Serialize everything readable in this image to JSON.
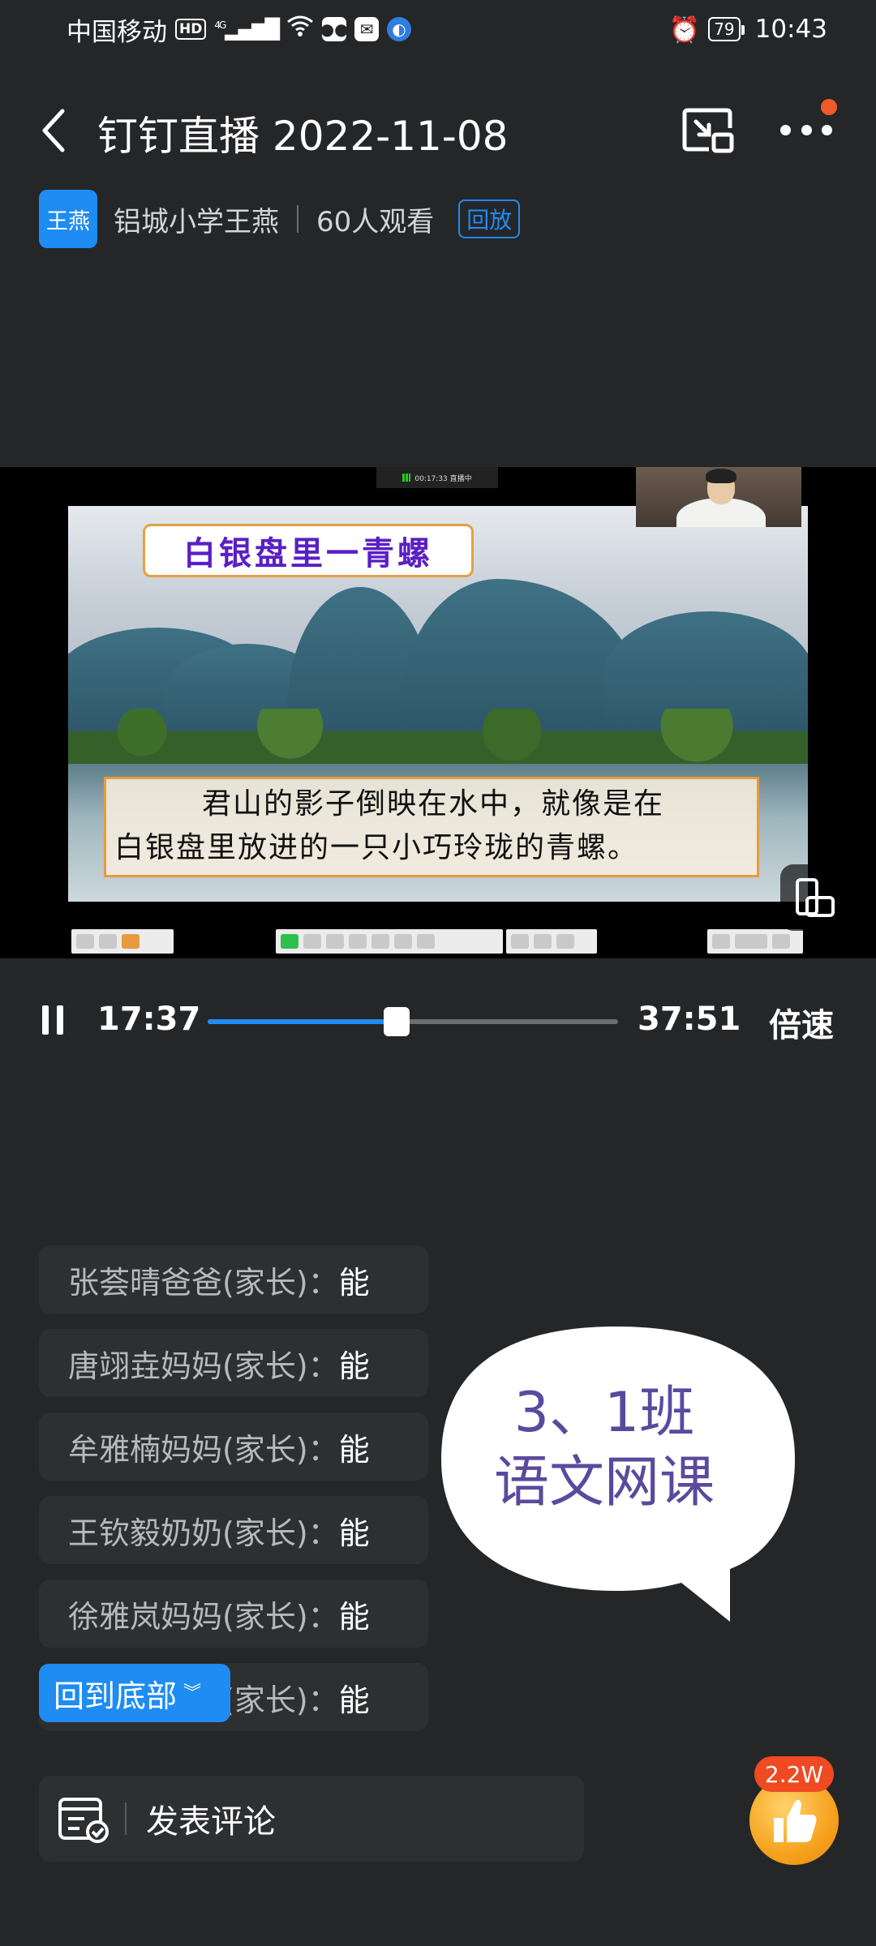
{
  "status_bar": {
    "carrier": "中国移动",
    "hd_label": "HD",
    "network": "4G",
    "battery": "79",
    "time": "10:43"
  },
  "header": {
    "title": "钉钉直播 2022-11-08",
    "back_icon": "chevron-left-icon",
    "pip_icon": "picture-in-picture-icon",
    "more_icon": "more-dots-icon"
  },
  "host": {
    "avatar_text": "王燕",
    "name": "铝城小学王燕",
    "viewers": "60人观看",
    "badge": "回放"
  },
  "video": {
    "rec_label": "00:17:33 直播中",
    "slide_title": "白银盘里一青螺",
    "slide_line1": "君山的影子倒映在水中，就像是在",
    "slide_line2": "白银盘里放进的一只小巧玲珑的青螺。"
  },
  "player": {
    "current_time": "17:37",
    "total_time": "37:51",
    "progress": 0.46,
    "speed_label": "倍速"
  },
  "comments": [
    {
      "name": "张荟晴爸爸(家长)：",
      "text": "能"
    },
    {
      "name": "唐翊垚妈妈(家长)：",
      "text": "能"
    },
    {
      "name": "牟雅楠妈妈(家长)：",
      "text": "能"
    },
    {
      "name": "王钦毅奶奶(家长)：",
      "text": "能"
    },
    {
      "name": "徐雅岚妈妈(家长)：",
      "text": "能"
    },
    {
      "name": "(家长)：",
      "text": "能"
    }
  ],
  "back_to_bottom": "回到底部",
  "bubble": {
    "line1": "3、1班",
    "line2": "语文网课"
  },
  "input": {
    "placeholder": "发表评论"
  },
  "like": {
    "count": "2.2W"
  },
  "colors": {
    "accent": "#1e8cf3",
    "background": "#252628",
    "like_badge": "#f04a22"
  }
}
